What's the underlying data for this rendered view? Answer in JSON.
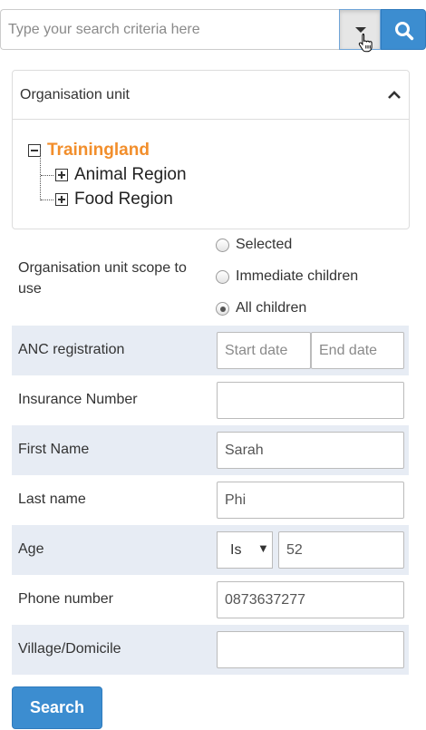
{
  "search": {
    "placeholder": "Type your search criteria here"
  },
  "org_panel": {
    "title": "Organisation unit",
    "root": "Trainingland",
    "children": [
      "Animal Region",
      "Food Region"
    ]
  },
  "scope": {
    "label": "Organisation unit scope to use",
    "options": [
      "Selected",
      "Immediate children",
      "All children"
    ],
    "selected": "All children"
  },
  "fields": {
    "anc": {
      "label": "ANC registration",
      "start_placeholder": "Start date",
      "end_placeholder": "End date"
    },
    "insurance": {
      "label": "Insurance Number",
      "value": ""
    },
    "first_name": {
      "label": "First Name",
      "value": "Sarah"
    },
    "last_name": {
      "label": "Last name",
      "value": "Phi"
    },
    "age": {
      "label": "Age",
      "operator": "Is",
      "value": "52"
    },
    "phone": {
      "label": "Phone number",
      "value": "0873637277"
    },
    "village": {
      "label": "Village/Domicile",
      "value": ""
    }
  },
  "buttons": {
    "search_label": "Search"
  },
  "colors": {
    "primary": "#3c8dd0",
    "root_node": "#f28e2b",
    "row_shade": "#e7ecf4"
  }
}
